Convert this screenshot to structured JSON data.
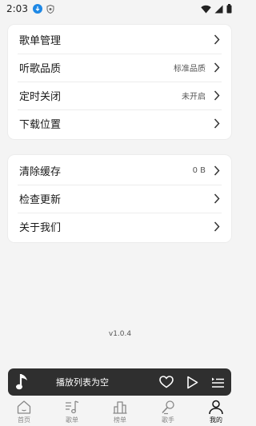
{
  "status_bar": {
    "time": "2:03",
    "icons": [
      "download-icon",
      "shield-icon",
      "wifi-icon",
      "signal-icon",
      "battery-icon"
    ]
  },
  "settings_card_1": {
    "items": [
      {
        "label": "歌单管理",
        "value": null
      },
      {
        "label": "听歌品质",
        "value": "标准品质"
      },
      {
        "label": "定时关闭",
        "value": "未开启"
      },
      {
        "label": "下载位置",
        "value": null
      }
    ]
  },
  "settings_card_2": {
    "items": [
      {
        "label": "清除缓存",
        "value": "0 B"
      },
      {
        "label": "检查更新",
        "value": null
      },
      {
        "label": "关于我们",
        "value": null
      }
    ]
  },
  "version": "v1.0.4",
  "player": {
    "title": "播放列表为空",
    "icons": [
      "music-note-icon",
      "heart-icon",
      "play-icon",
      "playlist-icon"
    ]
  },
  "tabbar": {
    "tabs": [
      {
        "label": "首页",
        "icon": "home-icon",
        "active": false
      },
      {
        "label": "歌单",
        "icon": "playlist-music-icon",
        "active": false
      },
      {
        "label": "榜单",
        "icon": "chart-bars-icon",
        "active": false
      },
      {
        "label": "歌手",
        "icon": "singer-icon",
        "active": false
      },
      {
        "label": "我的",
        "icon": "person-icon",
        "active": true
      }
    ]
  },
  "colors": {
    "background": "#f4f4f4",
    "card": "#ffffff",
    "player_bg": "#2f2f2f",
    "accent_blue": "#1e88e5"
  }
}
